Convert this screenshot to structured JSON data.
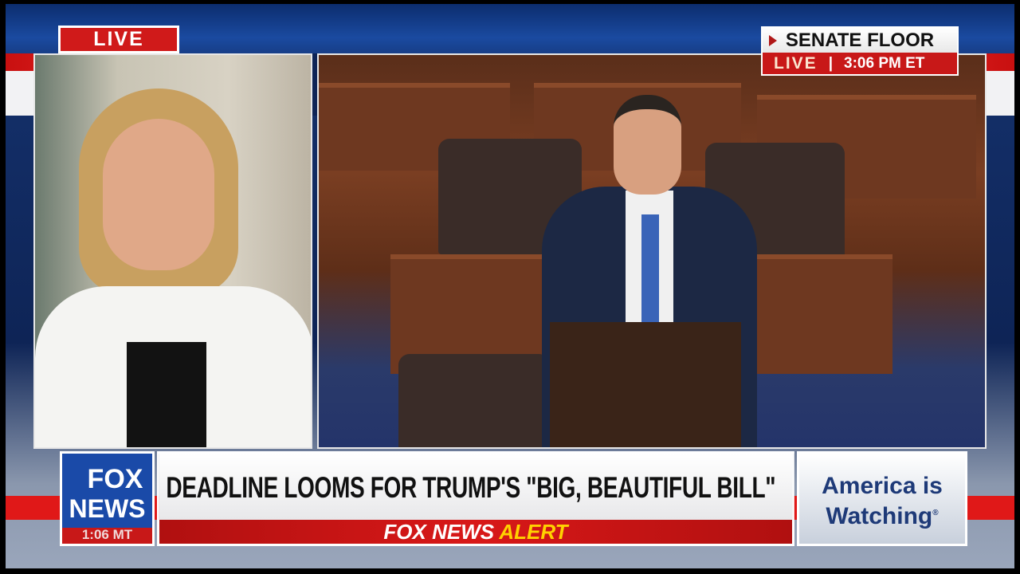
{
  "live_badge": "LIVE",
  "location": {
    "title": "SENATE FLOOR",
    "live": "LIVE",
    "separator": "|",
    "time": "3:06 PM ET"
  },
  "headline": "DEADLINE LOOMS FOR TRUMP'S \"BIG, BEAUTIFUL BILL\"",
  "alert": {
    "brand": "FOX NEWS",
    "label": "ALERT"
  },
  "logo": {
    "line1": "FOX",
    "line2": "NEWS",
    "time": "1:06 MT"
  },
  "promo": {
    "line1": "America is",
    "line2": "Watching",
    "mark": "®"
  },
  "colors": {
    "red": "#d01a1a",
    "blue": "#1a4aa8",
    "alert_yellow": "#ffd200",
    "navy_text": "#1e3a78"
  }
}
